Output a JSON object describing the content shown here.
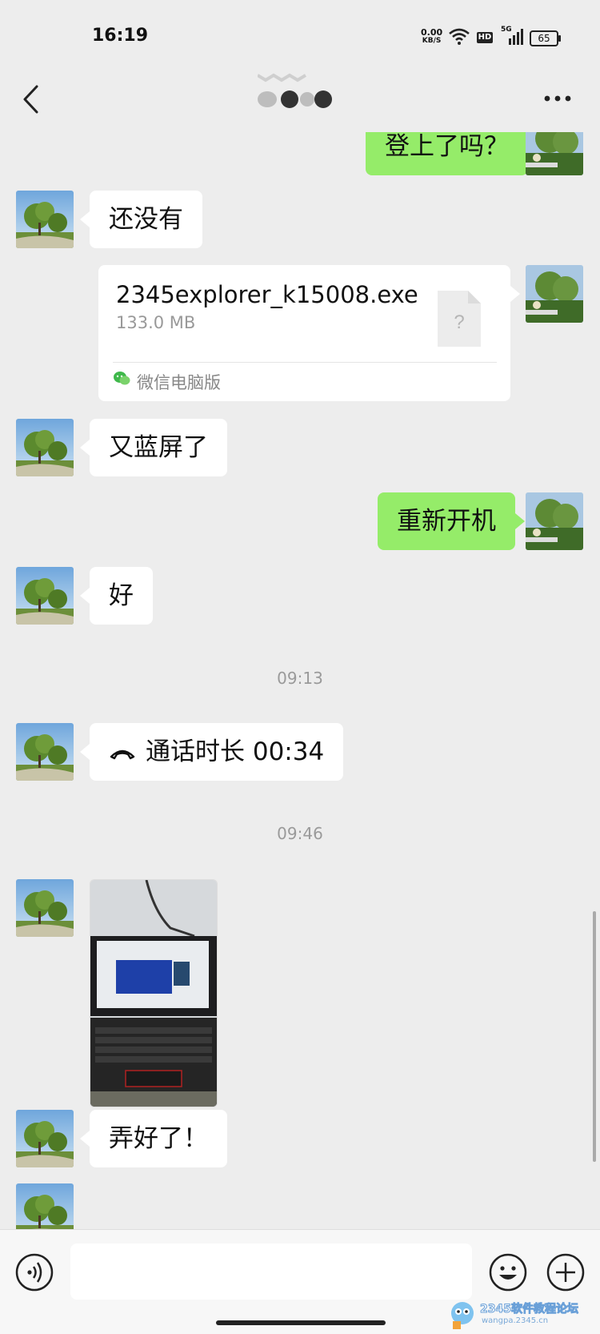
{
  "status_bar": {
    "time": "16:19",
    "net_speed_value": "0.00",
    "net_speed_unit": "KB/S",
    "hd": "HD",
    "signal_label": "5G",
    "battery": "65"
  },
  "header": {
    "back_icon": "chevron-left-icon",
    "more_icon": "more-dots-icon"
  },
  "messages": {
    "m1": "登上了吗？",
    "m2": "还没有",
    "file": {
      "name": "2345explorer_k15008.exe",
      "size": "133.0 MB",
      "source": "微信电脑版"
    },
    "m3": "又蓝屏了",
    "m4": "重新开机",
    "m5": "好",
    "ts1": "09:13",
    "call": "通话时长 00:34",
    "ts2": "09:46",
    "m6": "弄好了！"
  },
  "input_bar": {
    "placeholder": "",
    "voice_icon": "voice-icon",
    "emoji_icon": "emoji-icon",
    "add_icon": "plus-icon"
  },
  "watermark": {
    "title": "2345软件教程论坛",
    "url": "wangpa.2345.cn"
  },
  "colors": {
    "background": "#ededed",
    "bubble_self": "#95ec69",
    "bubble_other": "#ffffff"
  }
}
